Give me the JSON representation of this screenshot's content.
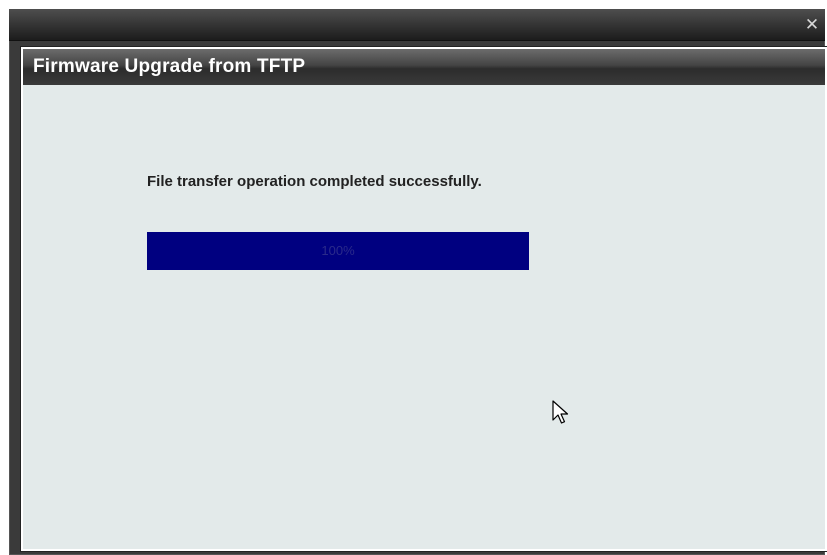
{
  "window": {
    "close_icon": "close-icon"
  },
  "dialog": {
    "title": "Firmware Upgrade from TFTP",
    "status_message": "File transfer operation completed successfully.",
    "progress": {
      "value_percent": 100,
      "label": "100%",
      "fill_color": "#000080"
    }
  },
  "colors": {
    "dialog_background": "#e3eaea",
    "header_background": "#3a3a3a",
    "title_text": "#ffffff"
  }
}
